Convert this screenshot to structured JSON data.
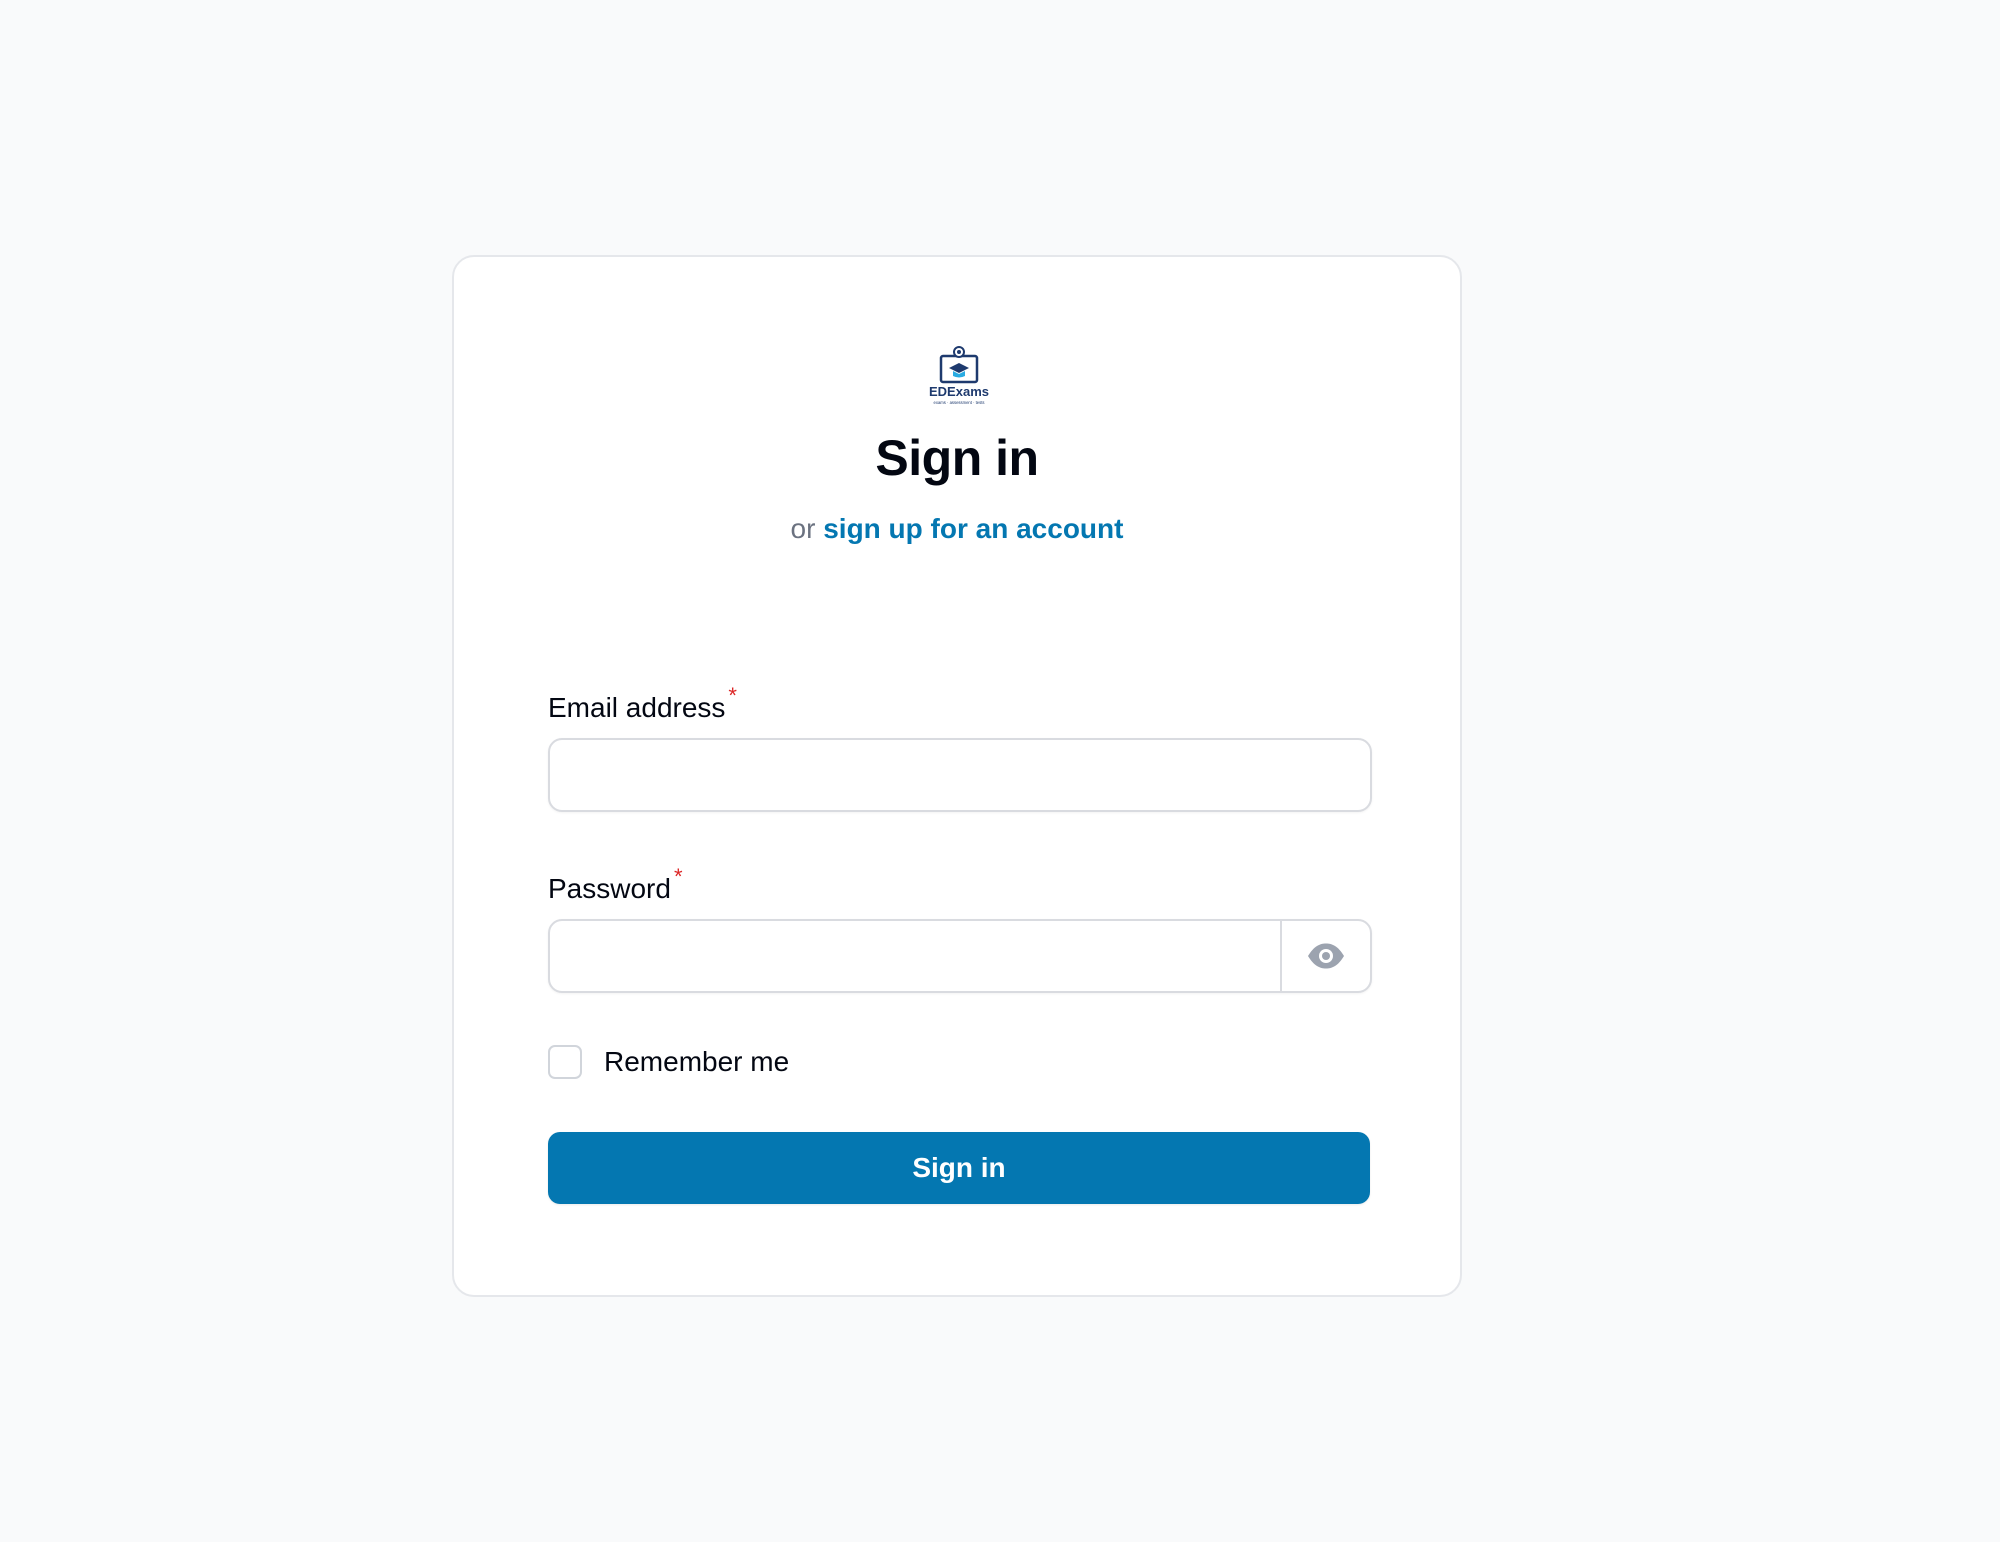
{
  "brand": {
    "logo_text": "EDExams",
    "logo_tagline": "exams · assessment · tests"
  },
  "header": {
    "title": "Sign in",
    "subtitle_prefix": "or",
    "signup_link": "sign up for an account"
  },
  "form": {
    "email": {
      "label": "Email address",
      "required_mark": "*",
      "value": "",
      "placeholder": ""
    },
    "password": {
      "label": "Password",
      "required_mark": "*",
      "value": "",
      "placeholder": "",
      "toggle_icon": "eye-icon"
    },
    "remember": {
      "label": "Remember me",
      "checked": false
    },
    "submit_label": "Sign in"
  },
  "colors": {
    "page_background": "#f9fafb",
    "accent": "#0477b1",
    "logo_navy": "#1e3a6e",
    "required": "#dc2626",
    "muted_text": "#6b7280"
  }
}
